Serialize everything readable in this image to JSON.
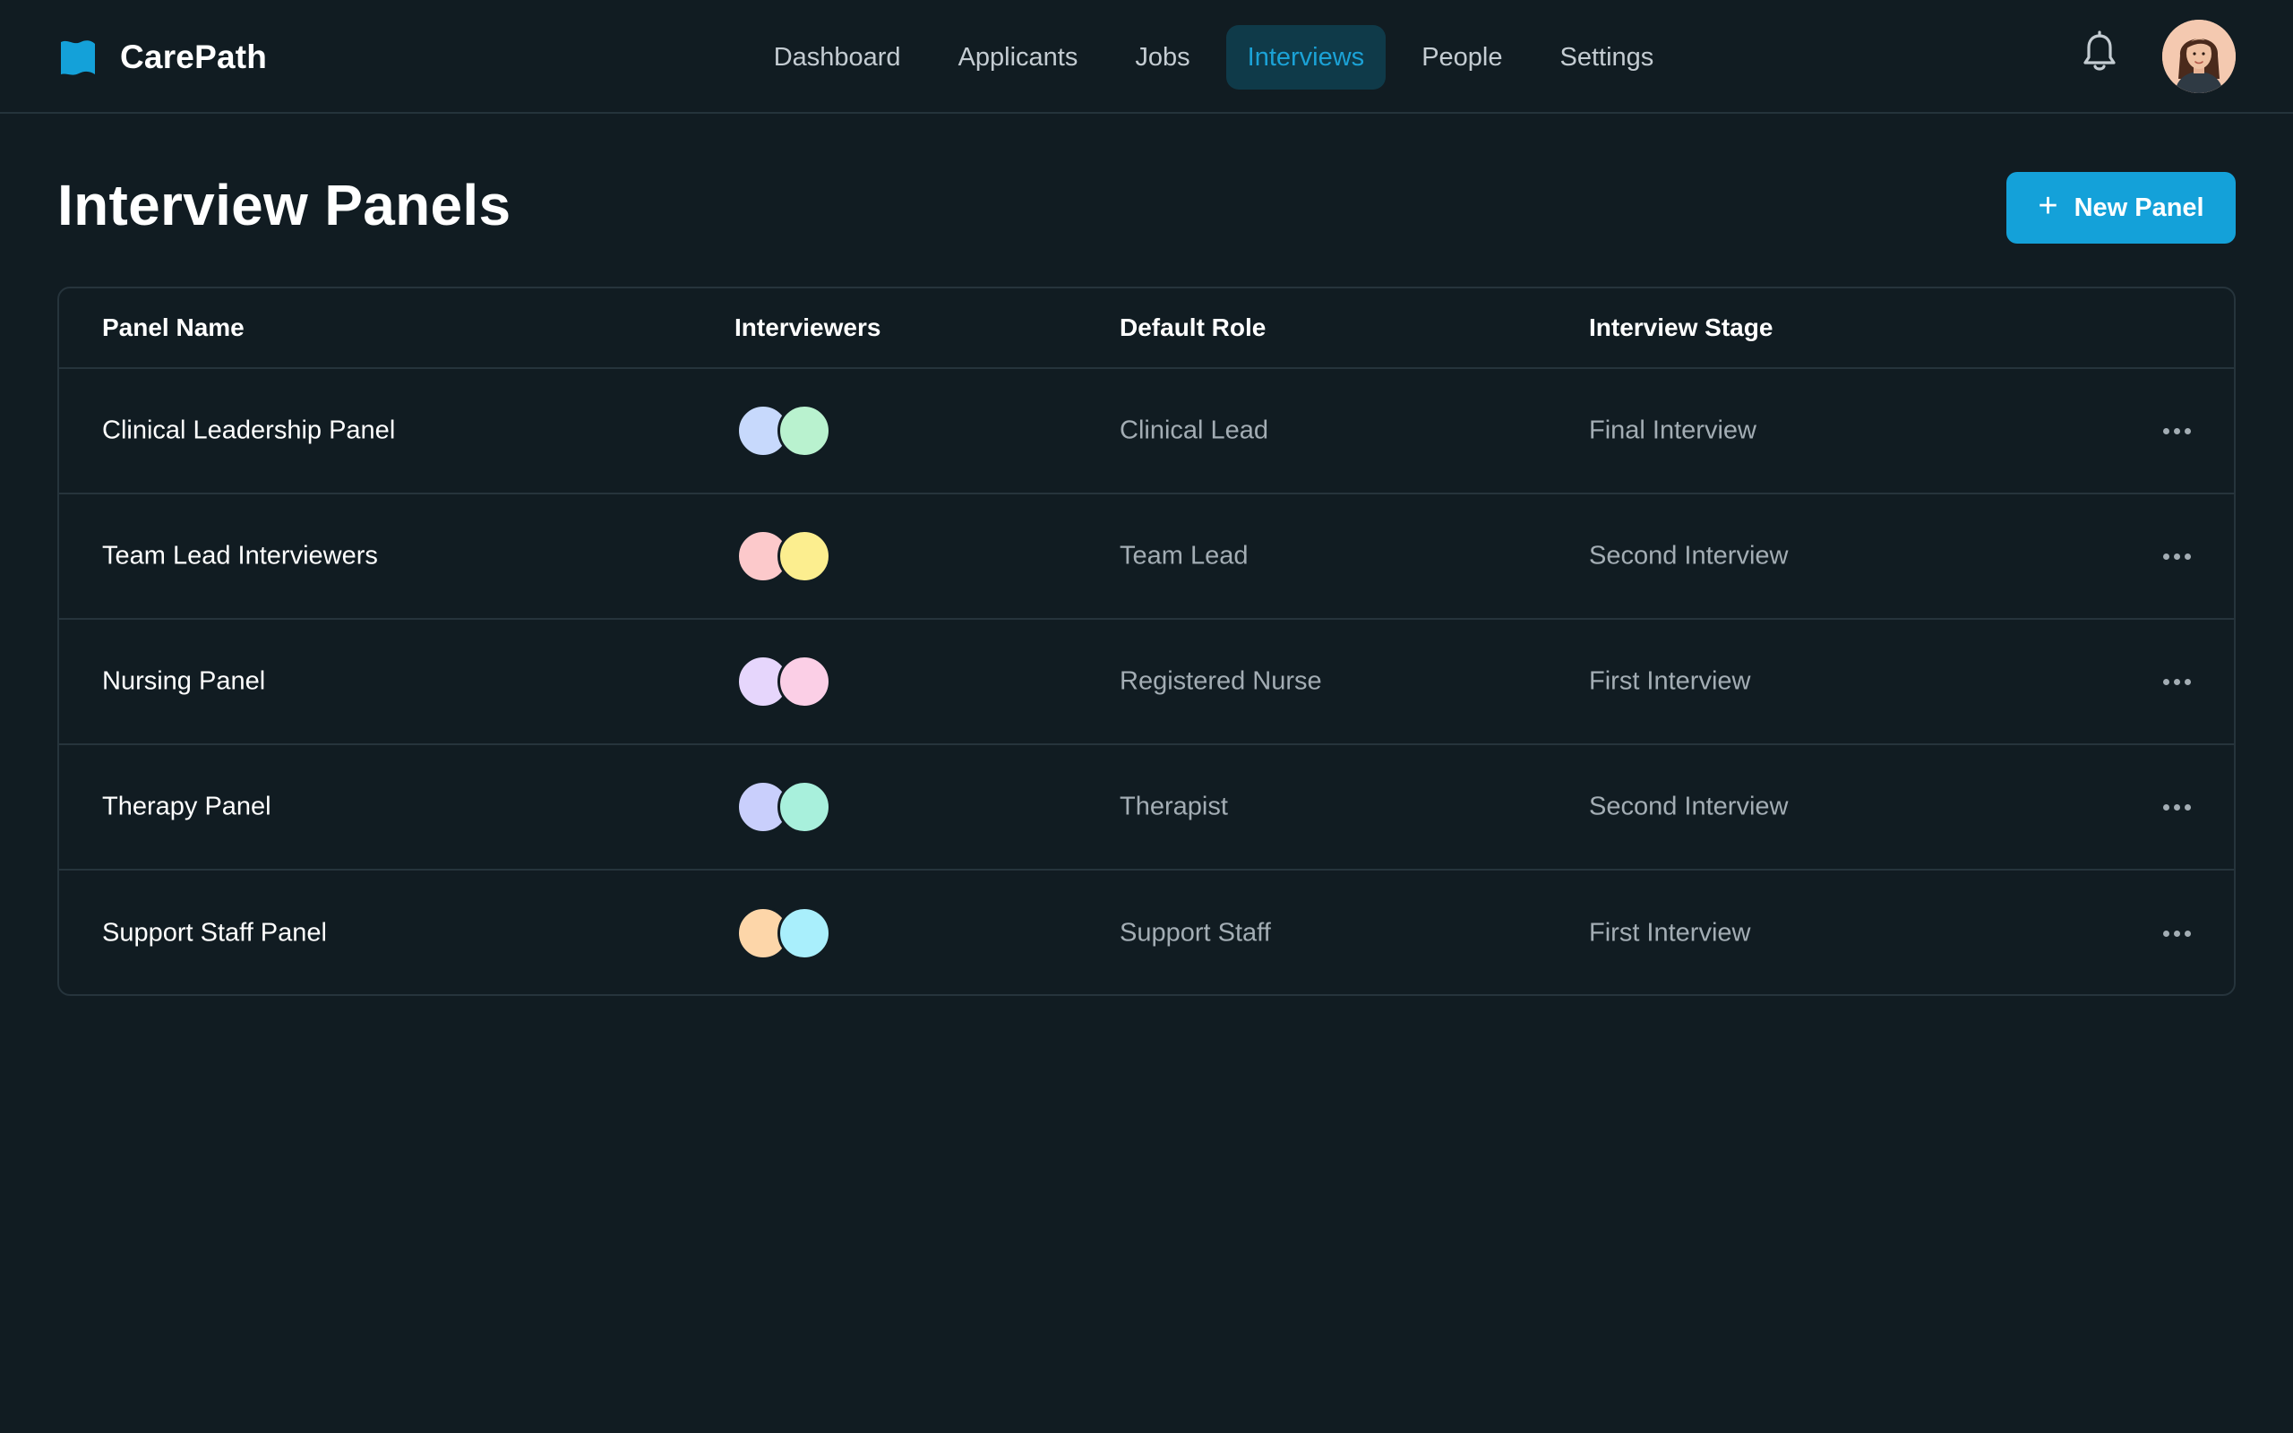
{
  "app": {
    "name": "CarePath",
    "brand_color": "#14a1d9"
  },
  "nav": {
    "items": [
      {
        "label": "Dashboard"
      },
      {
        "label": "Applicants"
      },
      {
        "label": "Jobs"
      },
      {
        "label": "Interviews",
        "active": true
      },
      {
        "label": "People"
      },
      {
        "label": "Settings"
      }
    ]
  },
  "header": {
    "title": "Interview Panels",
    "new_button_label": "New Panel",
    "new_button_icon": "plus-icon"
  },
  "table": {
    "columns": [
      "Panel Name",
      "Interviewers",
      "Default Role",
      "Interview Stage"
    ],
    "rows": [
      {
        "name": "Clinical Leadership Panel",
        "avatars": [
          "#c7d9fc",
          "#b9f2cf"
        ],
        "role": "Clinical Lead",
        "stage": "Final Interview"
      },
      {
        "name": "Team Lead Interviewers",
        "avatars": [
          "#fcc9cb",
          "#fcee8f"
        ],
        "role": "Team Lead",
        "stage": "Second Interview"
      },
      {
        "name": "Nursing Panel",
        "avatars": [
          "#e6d6fc",
          "#fbcfe6"
        ],
        "role": "Registered Nurse",
        "stage": "First Interview"
      },
      {
        "name": "Therapy Panel",
        "avatars": [
          "#c9cffc",
          "#a8f0dc"
        ],
        "role": "Therapist",
        "stage": "Second Interview"
      },
      {
        "name": "Support Staff Panel",
        "avatars": [
          "#fdd6a9",
          "#a9effc"
        ],
        "role": "Support Staff",
        "stage": "First Interview"
      }
    ]
  }
}
